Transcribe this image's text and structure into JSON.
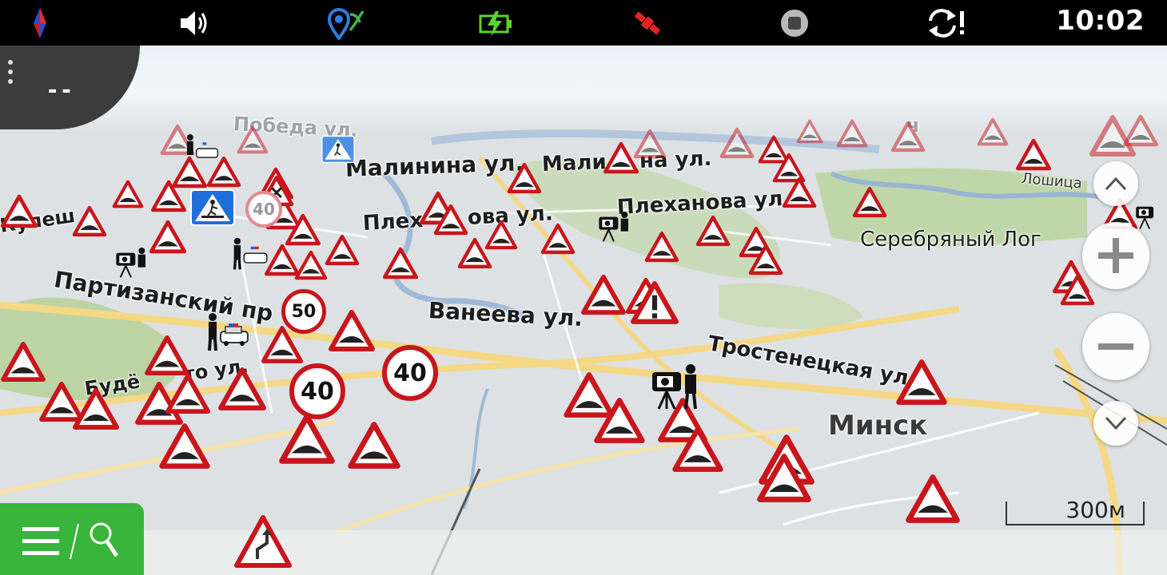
{
  "status_bar": {
    "time": "10:02",
    "icons": [
      "compass-icon",
      "volume-icon",
      "location-pin-icon",
      "battery-charging-icon",
      "satellite-icon",
      "stop-icon",
      "sync-alert-icon"
    ]
  },
  "top_left_panel": {
    "value": "--",
    "menu_icon": "more-vertical-icon"
  },
  "map": {
    "street_labels": [
      "Малинина ул.",
      "Мали",
      "на ул.",
      "Плех",
      "ова ул.",
      "Плеханова ул.",
      "Партизанский пр",
      "Ванеева ул.",
      "Тростенецкая ул",
      "Будё",
      "то ул.",
      "Кулеш",
      "Победа ул.",
      "ч"
    ],
    "area_labels": [
      "Серебряный Лог",
      "Минск",
      "Лошица"
    ],
    "speed_limits": [
      "40",
      "40",
      "50",
      "40"
    ]
  },
  "controls": {
    "zoom_in_icon": "plus-icon",
    "zoom_out_icon": "minus-icon",
    "tilt_up_icon": "chevron-up-icon",
    "tilt_down_icon": "chevron-down-icon",
    "menu_icon": "hamburger-icon",
    "search_icon": "search-icon"
  },
  "scale": {
    "label": "300м"
  },
  "next_maneuver_icon": "winding-road-icon",
  "colors": {
    "status_bar": "#000000",
    "menu_green": "#38b53a",
    "sign_red": "#c8161c"
  }
}
